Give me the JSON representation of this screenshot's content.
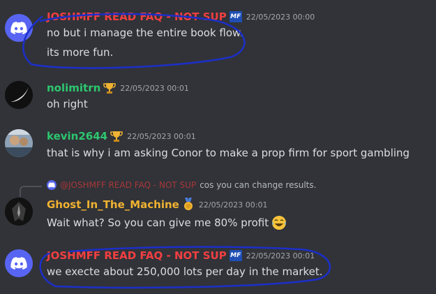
{
  "colors": {
    "background": "#313338",
    "mod_red": "#f23f42",
    "green_user": "#2dc770",
    "gold_user": "#f0b232",
    "text": "#dbdee1",
    "muted": "#a3a6aa",
    "discord_blurple": "#5865f2",
    "annotation_blue": "#1c2fc9"
  },
  "messages": [
    {
      "author": "JOSHMFF READ FAQ - NOT SUP",
      "badge": "MF",
      "timestamp": "22/05/2023 00:00",
      "lines": [
        "no but i manage the entire book flow.",
        "its more fun."
      ],
      "avatar_icon": "discord-logo-icon"
    },
    {
      "author": "nolimitrn",
      "badge_icon": "trophy-icon",
      "timestamp": "22/05/2023 00:01",
      "lines": [
        "oh right"
      ],
      "avatar_icon": "moon-avatar"
    },
    {
      "author": "kevin2644",
      "badge_icon": "trophy-icon",
      "timestamp": "22/05/2023 00:01",
      "lines": [
        "that is why i am asking Conor to make a prop firm for sport gambling"
      ],
      "avatar_icon": "photo-avatar"
    },
    {
      "reply_to_author": "@JOSHMFF READ FAQ - NOT SUP",
      "reply_text": "cos you can change results.",
      "author": "Ghost_In_The_Machine",
      "badge_icon": "medal-icon",
      "timestamp": "22/05/2023 00:01",
      "lines": [
        "Wait what? So you can give me 80% profit"
      ],
      "trailing_emoji": "laughing-tears-emoji",
      "avatar_icon": "dark-mask-avatar"
    },
    {
      "author": "JOSHMFF READ FAQ - NOT SUP",
      "badge": "MF",
      "timestamp": "22/05/2023 00:01",
      "lines": [
        "we execte about 250,000 lots per day in the market."
      ],
      "avatar_icon": "discord-logo-icon"
    }
  ]
}
